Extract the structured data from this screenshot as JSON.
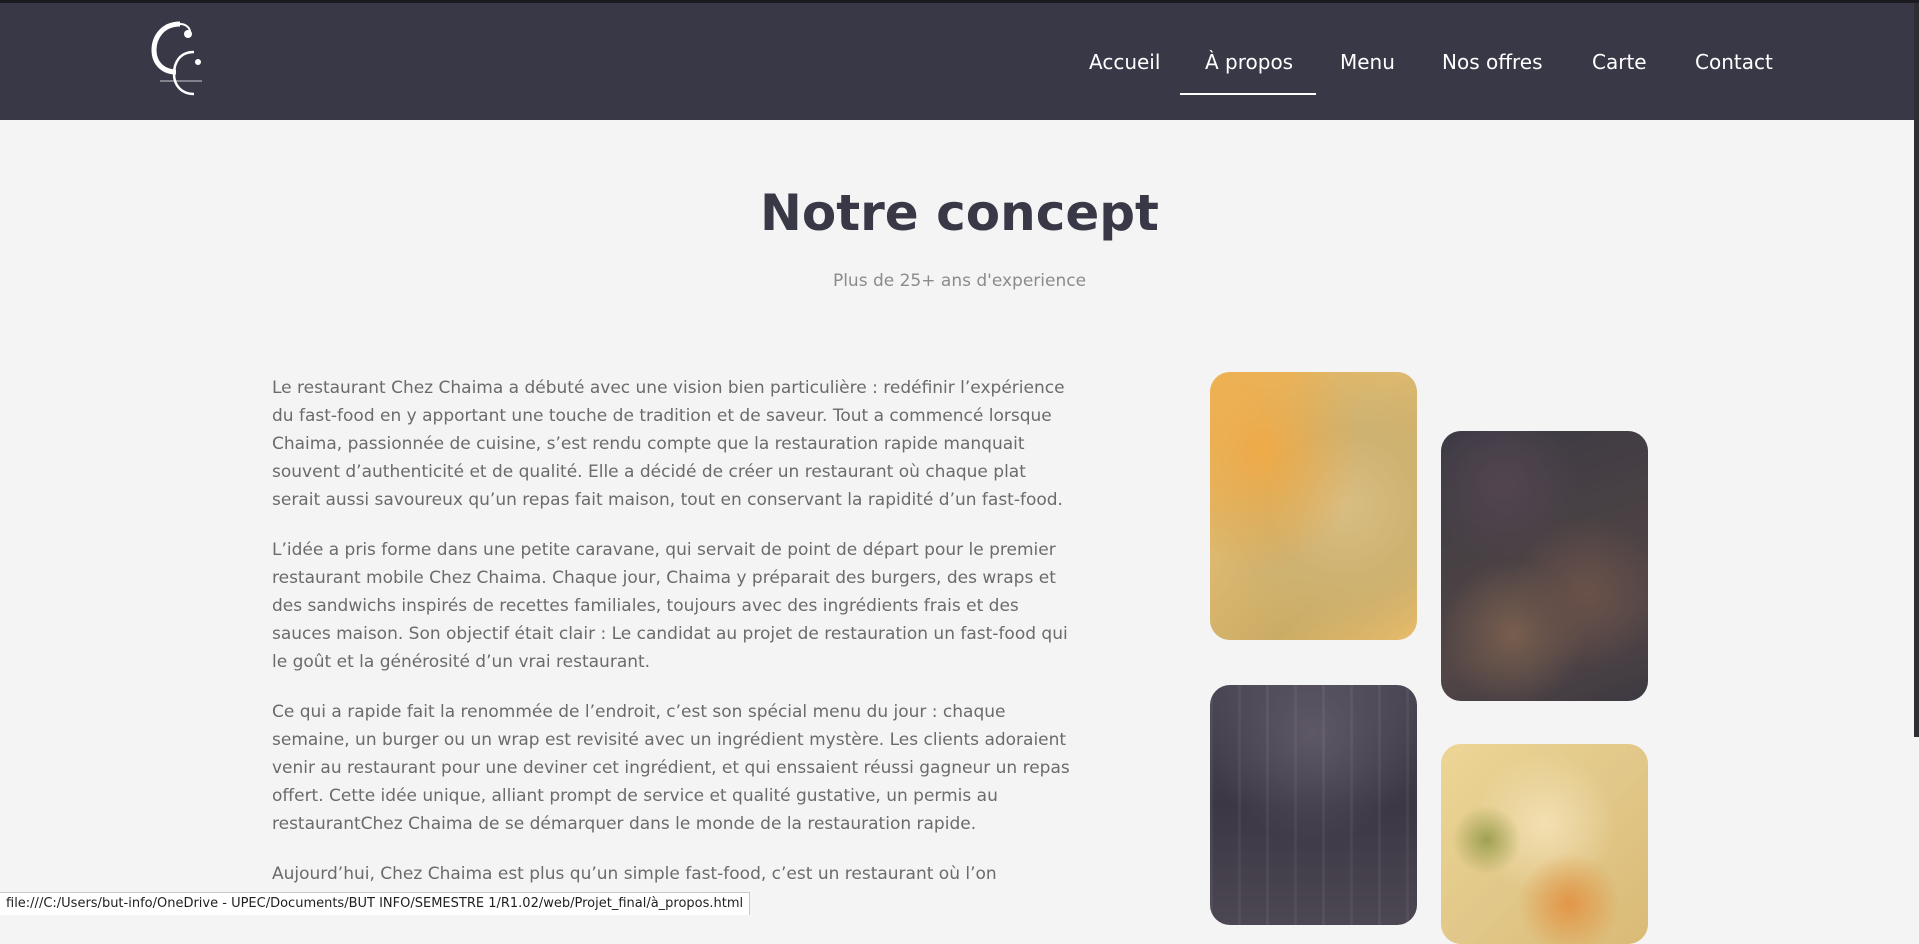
{
  "header": {
    "logo_icon": "chez-chaima-logo",
    "nav": [
      {
        "label": "Accueil"
      },
      {
        "label": "À propos",
        "active": true
      },
      {
        "label": "Menu"
      },
      {
        "label": "Nos offres"
      },
      {
        "label": "Carte"
      },
      {
        "label": "Contact"
      }
    ]
  },
  "main": {
    "title": "Notre concept",
    "subtitle": "Plus de 25+ ans d'experience",
    "paragraphs": [
      "Le restaurant Chez Chaima a débuté avec une vision bien particulière : redéfinir l’expérience du fast-food en y apportant une touche de tradition et de saveur. Tout a commencé lorsque Chaima, passionnée de cuisine, s’est rendu compte que la restauration rapide manquait souvent d’authenticité et de qualité. Elle a décidé de créer un restaurant où chaque plat serait aussi savoureux qu’un repas fait maison, tout en conservant la rapidité d’un fast-food.",
      "L’idée a pris forme dans une petite caravane, qui servait de point de départ pour le premier restaurant mobile Chez Chaima. Chaque jour, Chaima y préparait des burgers, des wraps et des sandwichs inspirés de recettes familiales, toujours avec des ingrédients frais et des sauces maison. Son objectif était clair : Le candidat au projet de restauration un fast-food qui le goût et la générosité d’un vrai restaurant.",
      "Ce qui a rapide fait la renommée de l’endroit, c’est son spécial menu du jour : chaque semaine, un burger ou un wrap est revisité avec un ingrédient mystère. Les clients adoraient venir au restaurant pour une deviner cet ingrédient, et qui enssaient réussi gagneur un repas offert. Cette idée unique, alliant prompt de service et qualité gustative, un permis au restaurantChez Chaima de se démarquer dans le monde de la restauration rapide.",
      "Aujourd’hui, Chez Chaima est plus qu’un simple fast-food, c’est un restaurant où l’on retrouve ... en temps record."
    ],
    "photos": [
      {
        "name": "grilled-food-photo"
      },
      {
        "name": "platter-photo"
      },
      {
        "name": "restaurant-interior-photo"
      },
      {
        "name": "salad-photo"
      }
    ]
  },
  "statusbar": {
    "url": "file:///C:/Users/but-info/OneDrive - UPEC/Documents/BUT INFO/SEMESTRE 1/R1.02/web/Projet_final/à_propos.html"
  },
  "colors": {
    "header_bg": "#393847",
    "page_bg": "#f4f4f4",
    "title": "#393847",
    "body_text": "#6b6b6b"
  }
}
